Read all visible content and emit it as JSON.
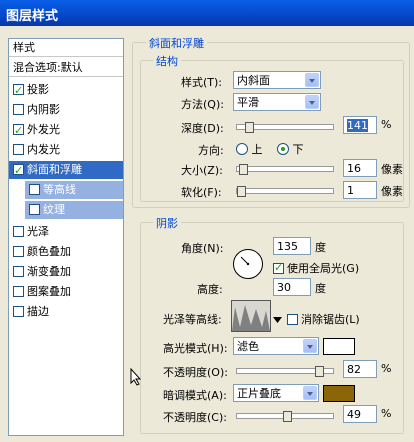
{
  "window": {
    "title": "图层样式"
  },
  "sidebar": {
    "header": "样式",
    "blend_options": "混合选项:默认",
    "items": [
      {
        "label": "投影",
        "checked": true
      },
      {
        "label": "内阴影",
        "checked": false
      },
      {
        "label": "外发光",
        "checked": true
      },
      {
        "label": "内发光",
        "checked": false
      },
      {
        "label": "斜面和浮雕",
        "checked": true,
        "selected": true
      },
      {
        "label": "等高线",
        "checked": false,
        "sub": true
      },
      {
        "label": "纹理",
        "checked": false,
        "sub": true
      },
      {
        "label": "光泽",
        "checked": false
      },
      {
        "label": "颜色叠加",
        "checked": false
      },
      {
        "label": "渐变叠加",
        "checked": false
      },
      {
        "label": "图案叠加",
        "checked": false
      },
      {
        "label": "描边",
        "checked": false
      }
    ]
  },
  "bevel": {
    "title": "斜面和浮雕",
    "structure_title": "结构",
    "style_label": "样式(T):",
    "style_value": "内斜面",
    "method_label": "方法(Q):",
    "method_value": "平滑",
    "depth_label": "深度(D):",
    "depth_value": "141",
    "depth_unit": "%",
    "depth_level_pct": 141,
    "direction_label": "方向:",
    "dir_up": "上",
    "dir_down": "下",
    "size_label": "大小(Z):",
    "size_value": "16",
    "size_unit": "像素",
    "soften_label": "软化(F):",
    "soften_value": "1",
    "soften_unit": "像素"
  },
  "shading": {
    "title": "阴影",
    "angle_label": "角度(N):",
    "angle_value": "135",
    "angle_unit": "度",
    "global_light_label": "使用全局光(G)",
    "altitude_label": "高度:",
    "altitude_value": "30",
    "altitude_unit": "度",
    "gloss_label": "光泽等高线:",
    "anti_alias_label": "消除锯齿(L)",
    "highlight_mode_label": "高光模式(H):",
    "highlight_mode_value": "滤色",
    "highlight_color": "#FFFFFF",
    "opacity1_label": "不透明度(O):",
    "opacity1_value": "82",
    "opacity1_unit": "%",
    "shadow_mode_label": "暗调模式(A):",
    "shadow_mode_value": "正片叠底",
    "shadow_color": "#8B6508",
    "opacity2_label": "不透明度(C):",
    "opacity2_value": "49",
    "opacity2_unit": "%"
  }
}
